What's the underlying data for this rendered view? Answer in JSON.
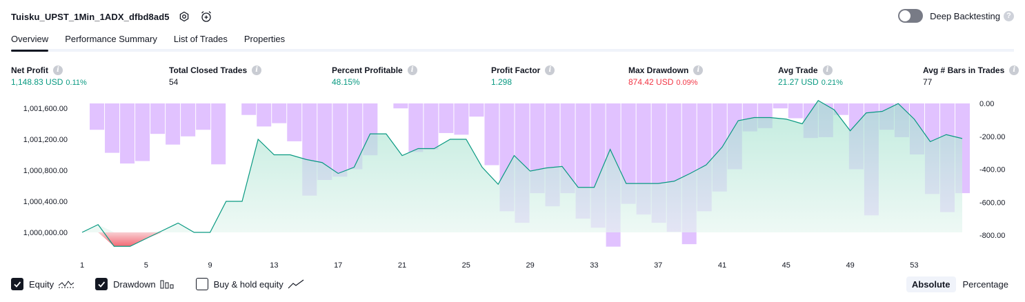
{
  "header": {
    "strategy_name": "Tuisku_UPST_1Min_1ADX_dfbd8ad5",
    "icons": [
      "settings-icon",
      "alarm-add-icon"
    ]
  },
  "deep_backtesting": {
    "label": "Deep Backtesting",
    "enabled": false,
    "help": "?"
  },
  "tabs": [
    {
      "label": "Overview",
      "active": true
    },
    {
      "label": "Performance Summary",
      "active": false
    },
    {
      "label": "List of Trades",
      "active": false
    },
    {
      "label": "Properties",
      "active": false
    }
  ],
  "metrics": [
    {
      "label": "Net Profit",
      "value": "1,148.83 USD",
      "pct": "0.11%",
      "color": "#089981"
    },
    {
      "label": "Total Closed Trades",
      "value": "54",
      "pct": "",
      "color": "#131722"
    },
    {
      "label": "Percent Profitable",
      "value": "48.15%",
      "pct": "",
      "color": "#089981"
    },
    {
      "label": "Profit Factor",
      "value": "1.298",
      "pct": "",
      "color": "#089981"
    },
    {
      "label": "Max Drawdown",
      "value": "874.42 USD",
      "pct": "0.09%",
      "color": "#f23645"
    },
    {
      "label": "Avg Trade",
      "value": "21.27 USD",
      "pct": "0.21%",
      "color": "#089981"
    },
    {
      "label": "Avg # Bars in Trades",
      "value": "77",
      "pct": "",
      "color": "#131722"
    }
  ],
  "chart_data": {
    "type": "line",
    "series": [
      {
        "name": "Equity",
        "axis": "left",
        "color": "#089981",
        "values": [
          1000000,
          1000100,
          999820,
          999820,
          999920,
          1000020,
          1000120,
          1000000,
          1000000,
          1000400,
          1000400,
          1001200,
          1001000,
          1001000,
          1000940,
          1000900,
          1000760,
          1000840,
          1001270,
          1001270,
          1000990,
          1001080,
          1001080,
          1001200,
          1001200,
          1000840,
          1000620,
          1000990,
          1000790,
          1000830,
          1000850,
          1000580,
          1000580,
          1001070,
          1000630,
          1000630,
          1000630,
          1000660,
          1000760,
          1000870,
          1001100,
          1001440,
          1001480,
          1001480,
          1001460,
          1001400,
          1001700,
          1001580,
          1001310,
          1001540,
          1001560,
          1001660,
          1001460,
          1001170,
          1001260,
          1001210
        ]
      },
      {
        "name": "Drawdown",
        "axis": "right",
        "color": "#dcb7ff",
        "values": [
          0,
          -160,
          -300,
          -365,
          -350,
          -185,
          -250,
          -200,
          -160,
          -370,
          0,
          -70,
          -140,
          -120,
          -230,
          -560,
          -465,
          -445,
          -400,
          -315,
          0,
          -30,
          -295,
          -280,
          -180,
          -190,
          -80,
          -375,
          -655,
          -725,
          -545,
          -625,
          -545,
          -700,
          -755,
          -870,
          -610,
          -675,
          -725,
          -780,
          -855,
          -655,
          -535,
          -400,
          -170,
          -150,
          -30,
          -90,
          -210,
          -205,
          -70,
          -400,
          -680,
          -160,
          -205,
          -310,
          -550,
          -660,
          -545
        ]
      }
    ],
    "x_ticks": [
      "1",
      "5",
      "9",
      "13",
      "17",
      "21",
      "25",
      "29",
      "33",
      "37",
      "41",
      "45",
      "49",
      "53"
    ],
    "y_left_ticks": [
      "1,001,600.00",
      "1,001,200.00",
      "1,000,800.00",
      "1,000,400.00",
      "1,000,000.00"
    ],
    "y_right_ticks": [
      "0.00",
      "-200.00",
      "-400.00",
      "-600.00",
      "-800.00"
    ],
    "ylim_left": [
      999820,
      1001665
    ],
    "ylim_right": [
      -870,
      0
    ],
    "grid": false,
    "legend": "bottom-left"
  },
  "footer": {
    "legend": [
      {
        "label": "Equity",
        "checked": true,
        "icon": "equity-line-icon"
      },
      {
        "label": "Drawdown",
        "checked": true,
        "icon": "drawdown-bars-icon"
      },
      {
        "label": "Buy & hold equity",
        "checked": false,
        "icon": "buy-hold-line-icon"
      }
    ],
    "modes": [
      {
        "label": "Absolute",
        "active": true
      },
      {
        "label": "Percentage",
        "active": false
      }
    ]
  }
}
